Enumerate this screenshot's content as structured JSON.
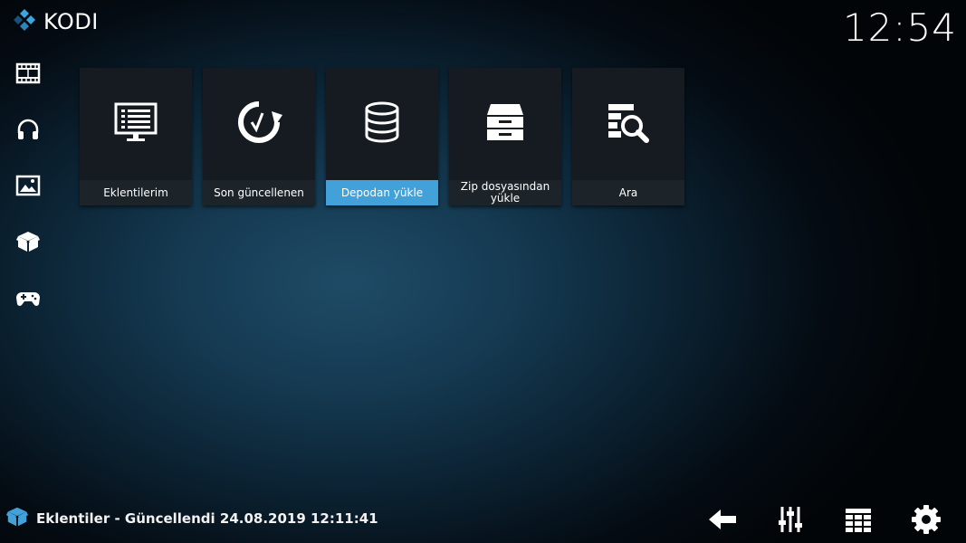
{
  "app": {
    "brand": "KODI",
    "clock": "12:54"
  },
  "sidebar": {
    "items": [
      {
        "name": "Filmler",
        "icon": "film-icon"
      },
      {
        "name": "Müzik",
        "icon": "headphones-icon"
      },
      {
        "name": "Resimler",
        "icon": "pictures-icon"
      },
      {
        "name": "Eklentiler",
        "icon": "addons-box-icon"
      },
      {
        "name": "Oyunlar",
        "icon": "gamepad-icon"
      }
    ]
  },
  "tiles": [
    {
      "label": "Eklentilerim",
      "icon": "monitor-list-icon",
      "focused": false
    },
    {
      "label": "Son güncellenen",
      "icon": "refresh-icon",
      "focused": false
    },
    {
      "label": "Depodan yükle",
      "icon": "database-icon",
      "focused": true
    },
    {
      "label": "Zip dosyasından yükle",
      "icon": "archive-box-icon",
      "focused": false
    },
    {
      "label": "Ara",
      "icon": "search-icon",
      "focused": false
    }
  ],
  "status": {
    "text": "Eklentiler - Güncellendi 24.08.2019 12:11:41"
  },
  "bottom_buttons": [
    {
      "icon": "back-arrow-icon"
    },
    {
      "icon": "sliders-icon"
    },
    {
      "icon": "grid-view-icon"
    },
    {
      "icon": "settings-gear-icon"
    }
  ],
  "colors": {
    "accent": "#43a1d9",
    "tile_bg": "#151b20",
    "label_bg": "#1c2329",
    "logo_light": "#3aa8e0",
    "logo_dark": "#17507a"
  }
}
